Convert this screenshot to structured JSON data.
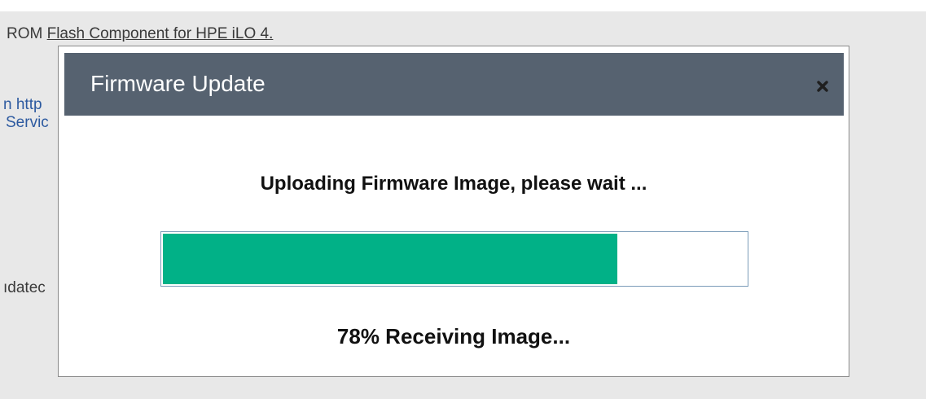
{
  "background": {
    "top_line_prefix": "ROM ",
    "top_line_link": "Flash Component for HPE iLO 4.",
    "line_1": "n http",
    "line_2": "Servic",
    "line_3": "ıdatec"
  },
  "dialog": {
    "title": "Firmware Update",
    "close_icon": "close-icon",
    "status_heading": "Uploading Firmware Image, please wait ...",
    "progress": {
      "percent": 78,
      "label": "78% Receiving Image..."
    }
  },
  "colors": {
    "header_bg": "#566270",
    "progress_fill": "#01b187",
    "page_bg": "#e8e8e8",
    "link": "#2d5aa0"
  }
}
